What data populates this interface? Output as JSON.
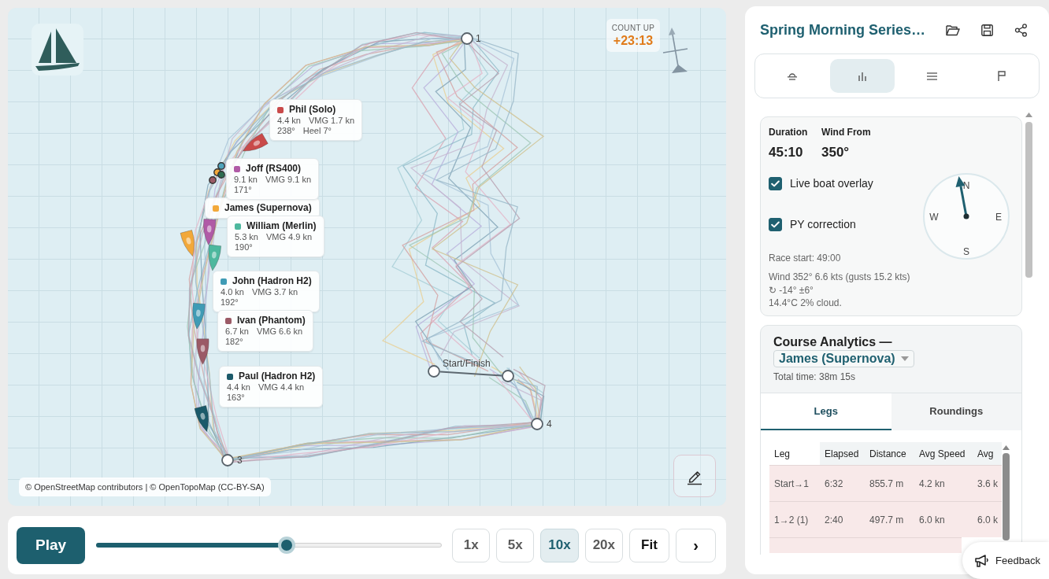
{
  "map": {
    "count_up": {
      "label": "COUNT UP",
      "value": "+23:13"
    },
    "marks": [
      {
        "kind": "buoy",
        "label": "1"
      },
      {
        "kind": "line",
        "label": "Start/Finish"
      },
      {
        "kind": "buoy",
        "label": "4"
      },
      {
        "kind": "buoy",
        "label": "3"
      }
    ],
    "boats": [
      {
        "name": "Phil (Solo)",
        "color": "#c94a4a",
        "speed": "4.4 kn",
        "vmg": "VMG 1.7 kn",
        "heading": "238°",
        "heel": "Heel 7°"
      },
      {
        "name": "Joff (RS400)",
        "color": "#b05aa6",
        "speed": "9.1 kn",
        "vmg": "VMG 9.1 kn",
        "heading": "171°"
      },
      {
        "name": "James (Supernova)",
        "color": "#f2a83a"
      },
      {
        "name": "William (Merlin)",
        "color": "#4db89e",
        "speed": "5.3 kn",
        "vmg": "VMG 4.9 kn",
        "heading": "190°"
      },
      {
        "name": "John (Hadron H2)",
        "color": "#3f9bb5",
        "speed": "4.0 kn",
        "vmg": "VMG 3.7 kn",
        "heading": "192°"
      },
      {
        "name": "Ivan (Phantom)",
        "color": "#9b5a66",
        "speed": "6.7 kn",
        "vmg": "VMG 6.6 kn",
        "heading": "182°"
      },
      {
        "name": "Paul (Hadron H2)",
        "color": "#1b5a6a",
        "speed": "4.4 kn",
        "vmg": "VMG 4.4 kn",
        "heading": "163°"
      }
    ],
    "attribution": "© OpenStreetMap contributors | © OpenTopoMap (CC-BY-SA)"
  },
  "playback": {
    "play": "Play",
    "level": 0.55,
    "speeds": [
      {
        "label": "1x",
        "selected": false
      },
      {
        "label": "5x",
        "selected": false
      },
      {
        "label": "10x",
        "selected": true
      },
      {
        "label": "20x",
        "selected": false
      }
    ],
    "fit": "Fit",
    "next": "›"
  },
  "panel": {
    "title": "Spring Morning Series…",
    "tabs": [
      {
        "selected": false
      },
      {
        "selected": true
      },
      {
        "selected": false
      },
      {
        "selected": false
      }
    ],
    "summary": {
      "stats": [
        {
          "label": "Duration",
          "value": "45:10"
        },
        {
          "label": "Wind From",
          "value": "350°"
        }
      ],
      "toggles": [
        {
          "label": "Live boat overlay",
          "checked": true
        },
        {
          "label": "PY correction",
          "checked": true
        }
      ],
      "compass": [
        "N",
        "E",
        "S",
        "W"
      ],
      "race_start": "Race start: 49:00",
      "weather": [
        "Wind 352° 6.6 kts (gusts 15.2 kts) ↻ -14° ±6°",
        "14.4°C 2% cloud."
      ]
    },
    "analytics": {
      "title": "Course Analytics —",
      "racer": "James (Supernova)",
      "total_time": "Total time: 38m 15s",
      "tabs": [
        {
          "label": "Legs",
          "selected": true
        },
        {
          "label": "Roundings",
          "selected": false
        }
      ],
      "table": {
        "columns": [
          "Leg",
          "Elapsed",
          "Distance",
          "Avg Speed",
          "Avg"
        ],
        "rows": [
          [
            "Start→1",
            "6:32",
            "855.7 m",
            "4.2 kn",
            "3.6 k"
          ],
          [
            "1→2 (1)",
            "2:40",
            "497.7 m",
            "6.0 kn",
            "6.0 k"
          ]
        ]
      }
    }
  },
  "feedback": "Feedback"
}
